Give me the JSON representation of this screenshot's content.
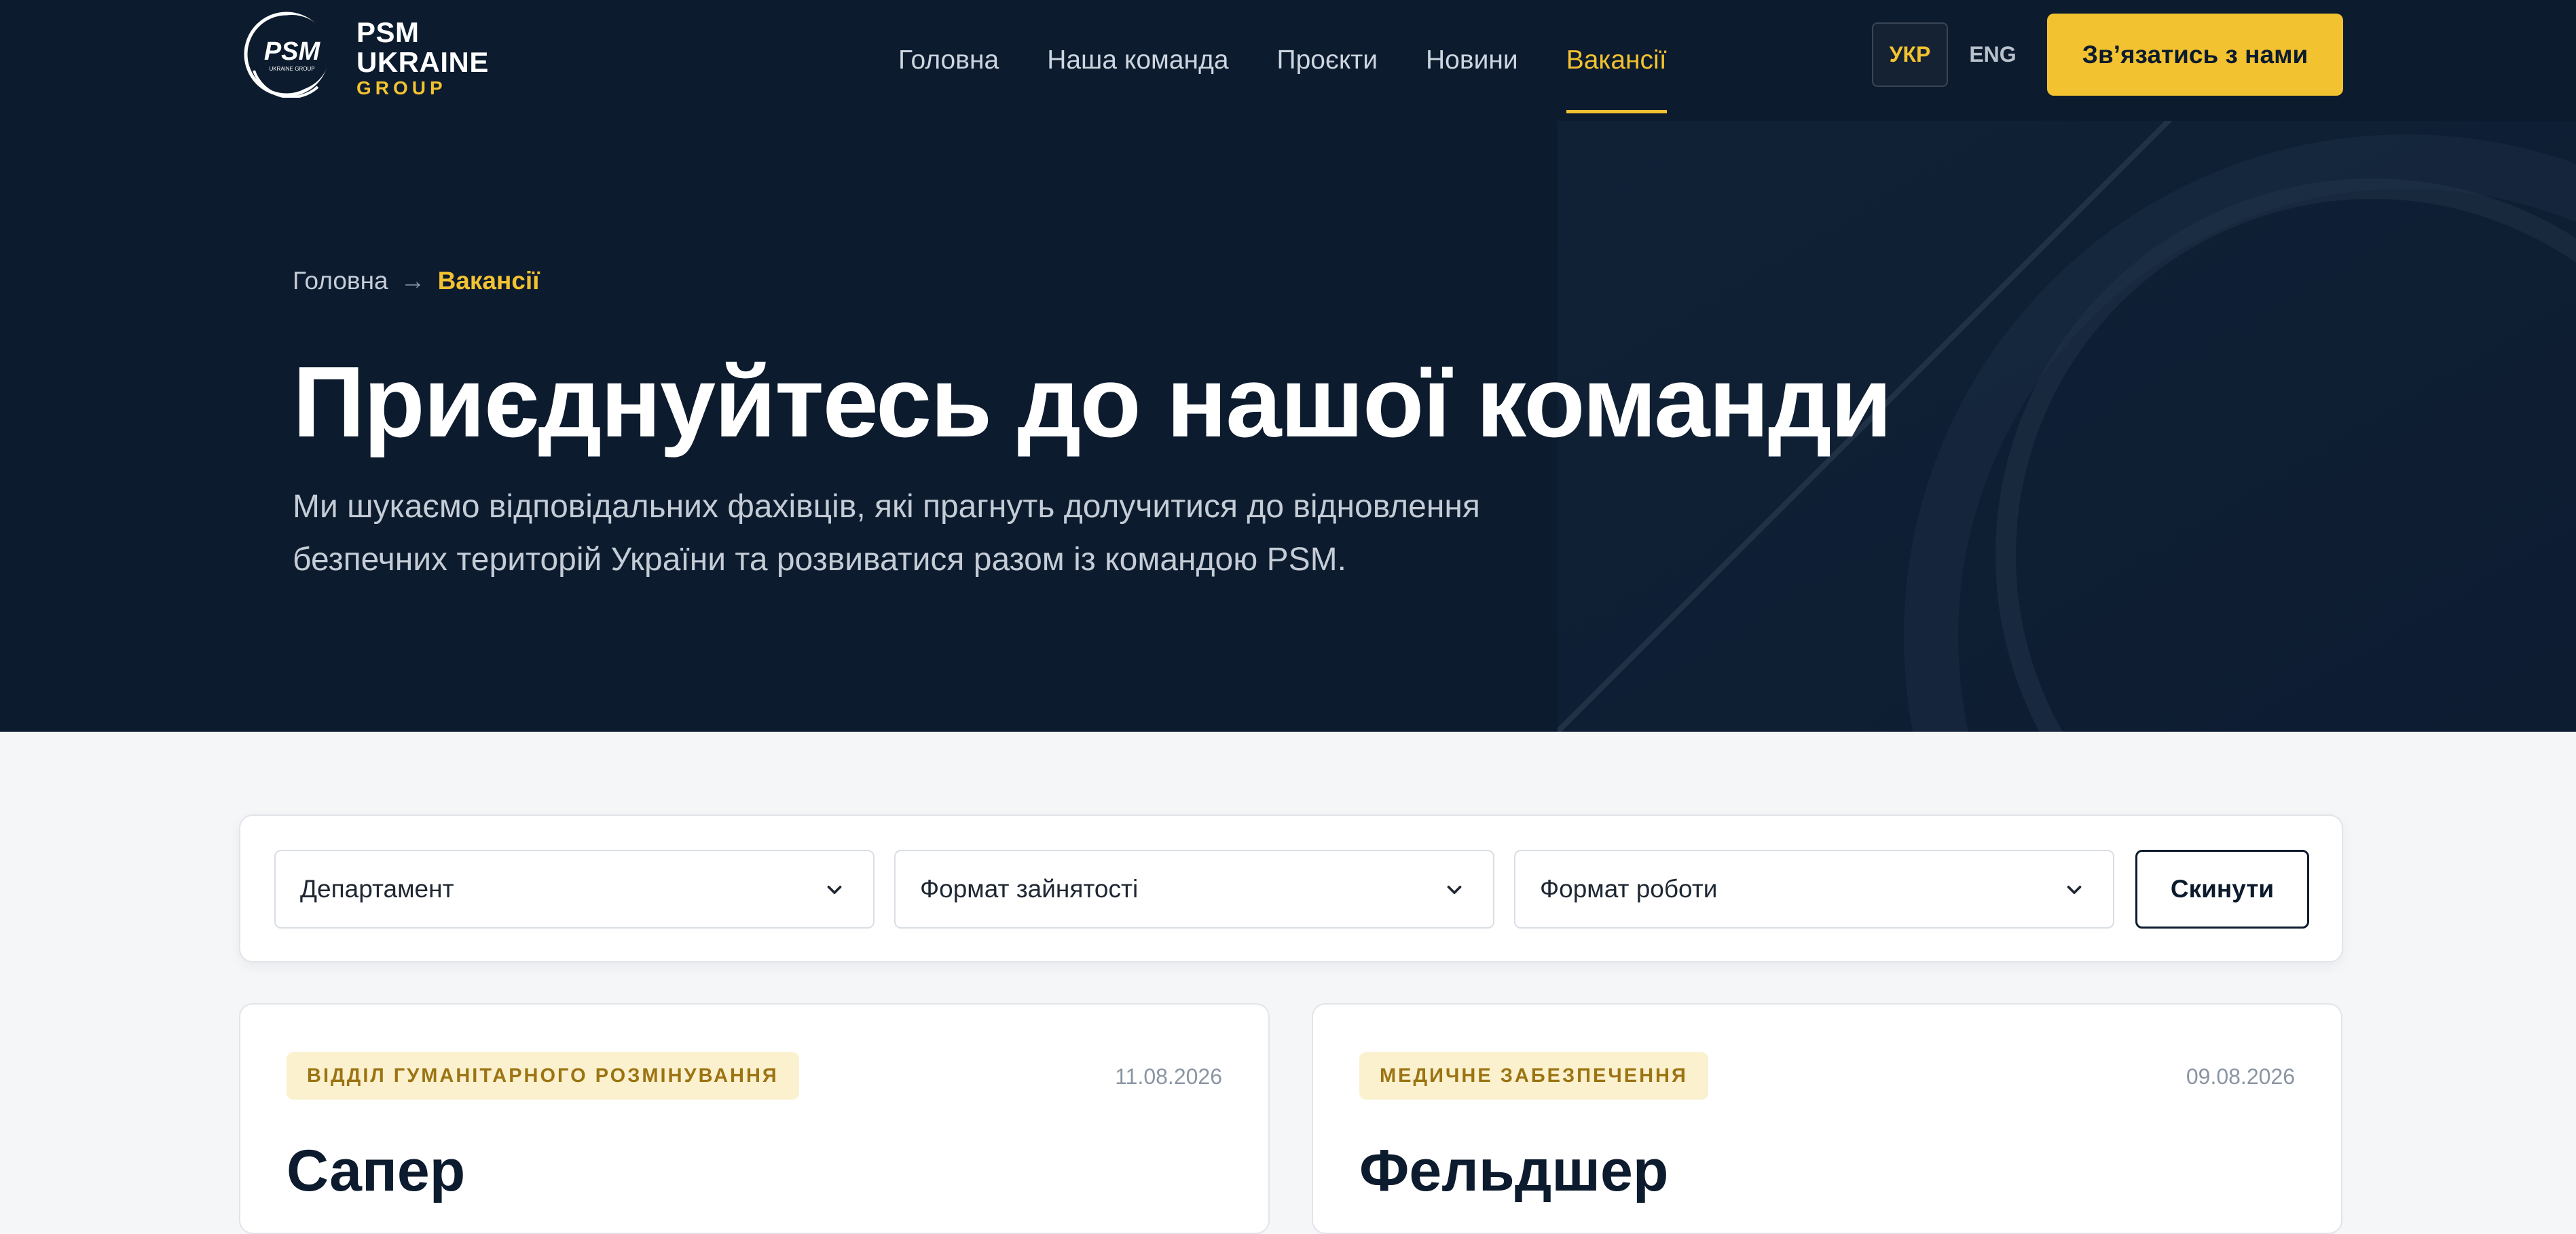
{
  "header": {
    "logo": {
      "mark": "PSM",
      "mark_sub": "UKRAINE GROUP",
      "line1": "PSM",
      "line2": "UKRAINE",
      "line3": "GROUP"
    },
    "nav": [
      {
        "label": "Головна"
      },
      {
        "label": "Наша команда"
      },
      {
        "label": "Проєкти"
      },
      {
        "label": "Новини"
      },
      {
        "label": "Вакансії",
        "active": true
      }
    ],
    "lang_ukr": "УКР",
    "lang_eng": "ENG",
    "contact_label": "Зв’язатись з нами"
  },
  "hero": {
    "breadcrumb": {
      "home": "Головна",
      "arrow": "→",
      "current": "Вакансії"
    },
    "title": "Приєднуйтесь до нашої команди",
    "subtitle": "Ми шукаємо відповідальних фахівців, які прагнуть долучитися до відновлення безпечних територій України та розвиватися разом із командою PSM."
  },
  "filters": {
    "department": "Департамент",
    "employment": "Формат зайнятості",
    "work_format": "Формат роботи",
    "reset_label": "Скинути"
  },
  "jobs": [
    {
      "department": "ВІДДІЛ ГУМАНІТАРНОГО РОЗМІНУВАННЯ",
      "date": "11.08.2026",
      "title": "Сапер"
    },
    {
      "department": "МЕДИЧНЕ ЗАБЕЗПЕЧЕННЯ",
      "date": "09.08.2026",
      "title": "Фельдшер"
    }
  ],
  "colors": {
    "navy": "#0c1b2e",
    "accent": "#f2c230",
    "page_bg": "#f4f6f8"
  },
  "icons": {
    "select_chevron": "chevron-down-icon"
  }
}
